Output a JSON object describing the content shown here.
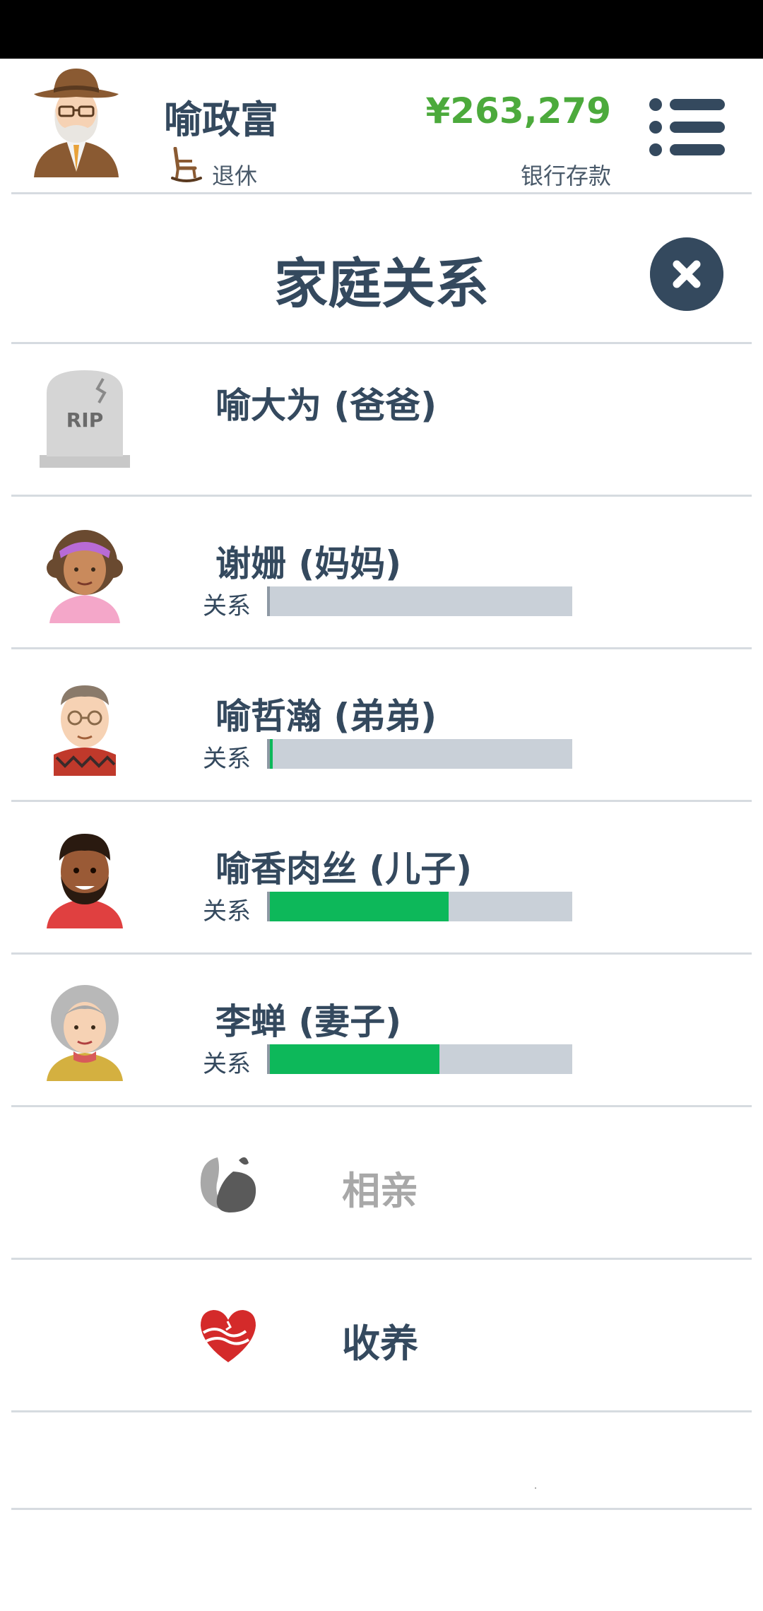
{
  "header": {
    "player_name": "喻政富",
    "job": "退休",
    "money": "¥263,279",
    "money_label": "银行存款"
  },
  "page_title": "家庭关系",
  "relation_label": "关系",
  "family": [
    {
      "name": "喻大为 (爸爸)",
      "deceased": true,
      "tombstone_text": "RIP"
    },
    {
      "name": "谢姗 (妈妈)",
      "relation": 0.0
    },
    {
      "name": "喻哲瀚 (弟弟)",
      "relation": 0.01
    },
    {
      "name": "喻香肉丝 (儿子)",
      "relation": 0.59
    },
    {
      "name": "李蝉 (妻子)",
      "relation": 0.56
    }
  ],
  "actions": [
    {
      "label": "相亲",
      "enabled": false
    },
    {
      "label": "收养",
      "enabled": true
    }
  ],
  "colors": {
    "primary": "#34495e",
    "money": "#4caa3c",
    "bar_fill": "#0db85a",
    "bar_bg": "#c9d0d8",
    "disabled": "#a8a8a8",
    "adopt_heart": "#d42a2a"
  }
}
